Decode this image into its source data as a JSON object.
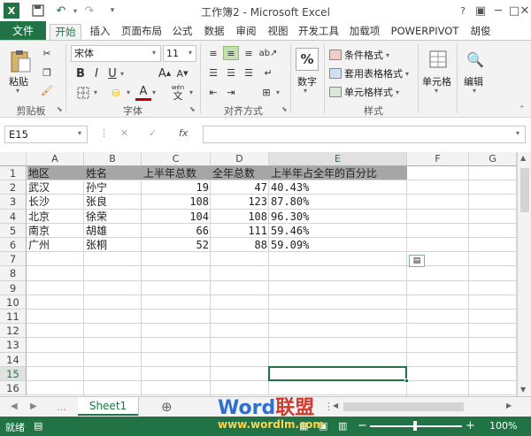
{
  "window": {
    "title": "工作簿2 - Microsoft Excel",
    "help": "?",
    "user": "胡俊"
  },
  "tabs": [
    "文件",
    "开始",
    "插入",
    "页面布局",
    "公式",
    "数据",
    "审阅",
    "视图",
    "开发工具",
    "加载项",
    "POWERPIVOT"
  ],
  "ribbon": {
    "clipboard": {
      "paste": "粘贴",
      "label": "剪贴板"
    },
    "font": {
      "name": "宋体",
      "size": "11",
      "bold": "B",
      "italic": "I",
      "underline": "U",
      "grow": "A",
      "shrink": "A",
      "color_letter": "A",
      "wen": "wén",
      "wen_char": "文",
      "label": "字体"
    },
    "align": {
      "label": "对齐方式"
    },
    "number": {
      "percent": "%",
      "label_btn": "数字"
    },
    "styles": {
      "cond": "条件格式",
      "table": "套用表格格式",
      "cell": "单元格样式",
      "label": "样式"
    },
    "cells": {
      "label_btn": "单元格"
    },
    "edit": {
      "label_btn": "编辑"
    }
  },
  "formula_bar": {
    "name_box": "E15",
    "fx": "fx",
    "value": ""
  },
  "grid": {
    "columns": [
      "A",
      "B",
      "C",
      "D",
      "E",
      "F",
      "G"
    ],
    "rows": [
      "1",
      "2",
      "3",
      "4",
      "5",
      "6",
      "7",
      "8",
      "9",
      "10",
      "11",
      "12",
      "13",
      "14",
      "15",
      "16"
    ],
    "header_row": [
      "地区",
      "姓名",
      "上半年总数",
      "全年总数",
      "上半年占全年的百分比"
    ],
    "data": [
      [
        "武汉",
        "孙宁",
        "19",
        "47",
        "40.43%"
      ],
      [
        "长沙",
        "张良",
        "108",
        "123",
        "87.80%"
      ],
      [
        "北京",
        "徐荣",
        "104",
        "108",
        "96.30%"
      ],
      [
        "南京",
        "胡雄",
        "66",
        "111",
        "59.46%"
      ],
      [
        "广州",
        "张桐",
        "52",
        "88",
        "59.09%"
      ]
    ],
    "selected_cell": "E15"
  },
  "sheets": {
    "tabs": [
      "Sheet1"
    ],
    "add": "⊕"
  },
  "status": {
    "ready": "就绪",
    "zoom": "100%",
    "minus": "−",
    "plus": "+"
  },
  "watermark": {
    "word": "Word",
    "cn": "联盟",
    "url": "www.wordlm.com"
  }
}
